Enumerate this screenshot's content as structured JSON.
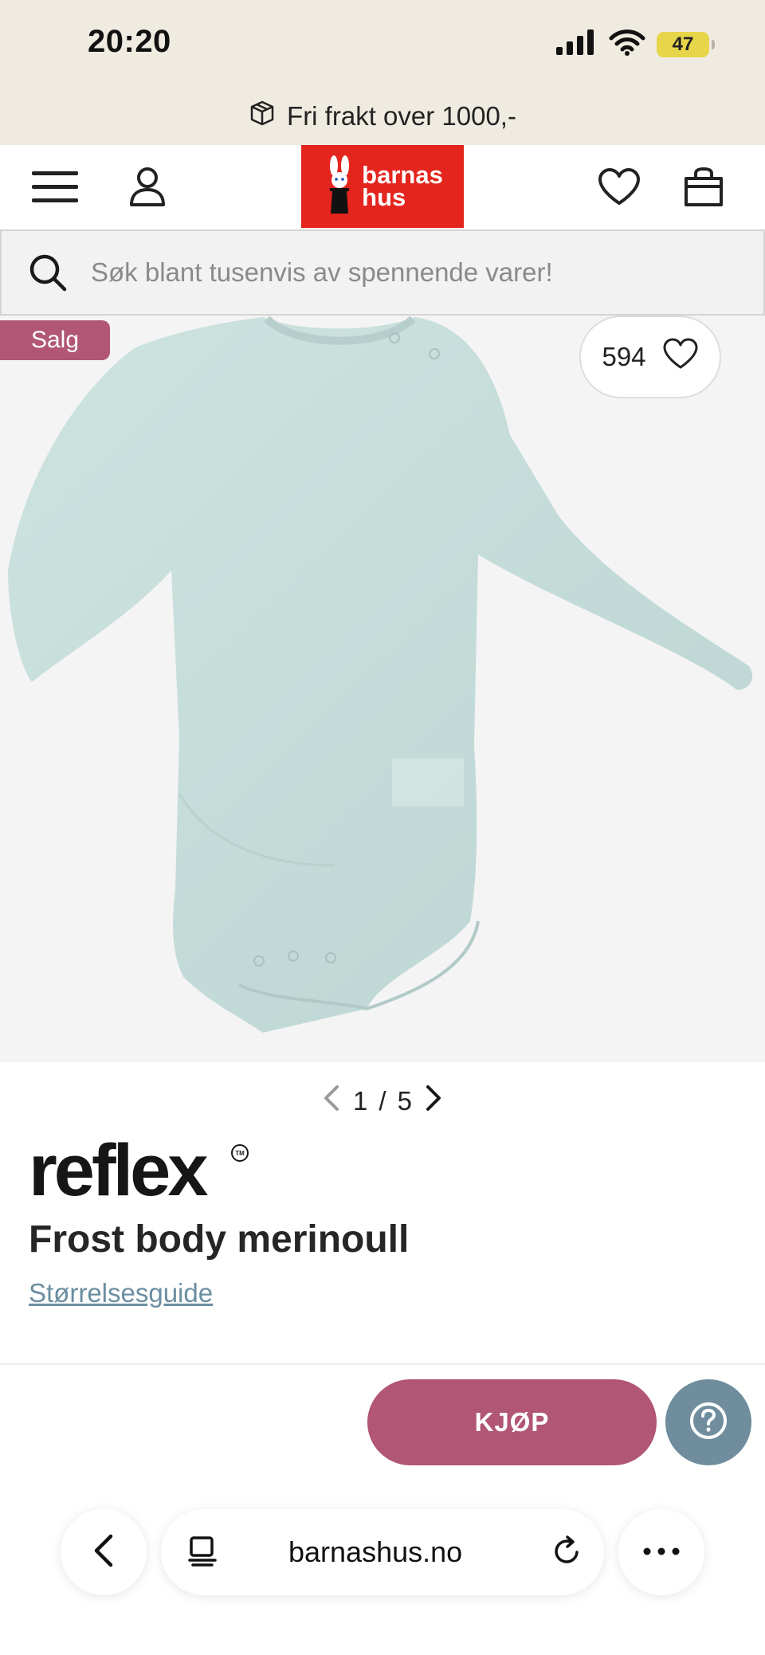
{
  "status": {
    "time": "20:20",
    "battery_level": "47"
  },
  "promo": {
    "text": "Fri frakt over 1000,-"
  },
  "header": {
    "logo_line1": "barnas",
    "logo_line2": "hus"
  },
  "search": {
    "placeholder": "Søk blant tusenvis av spennende varer!"
  },
  "product": {
    "sale_badge": "Salg",
    "favorites_count": "594",
    "image_current": "1",
    "image_separator": "/",
    "image_total": "5",
    "brand": "reflex",
    "title": "Frost body merinoull",
    "size_guide": "Størrelsesguide",
    "garment_color": "#c5dcd9"
  },
  "actions": {
    "buy_label": "KJØP"
  },
  "browser": {
    "url": "barnashus.no"
  },
  "colors": {
    "accent": "#b15675",
    "help": "#6f8d9d",
    "logo_red": "#e3251e",
    "link": "#6b8ea1"
  }
}
